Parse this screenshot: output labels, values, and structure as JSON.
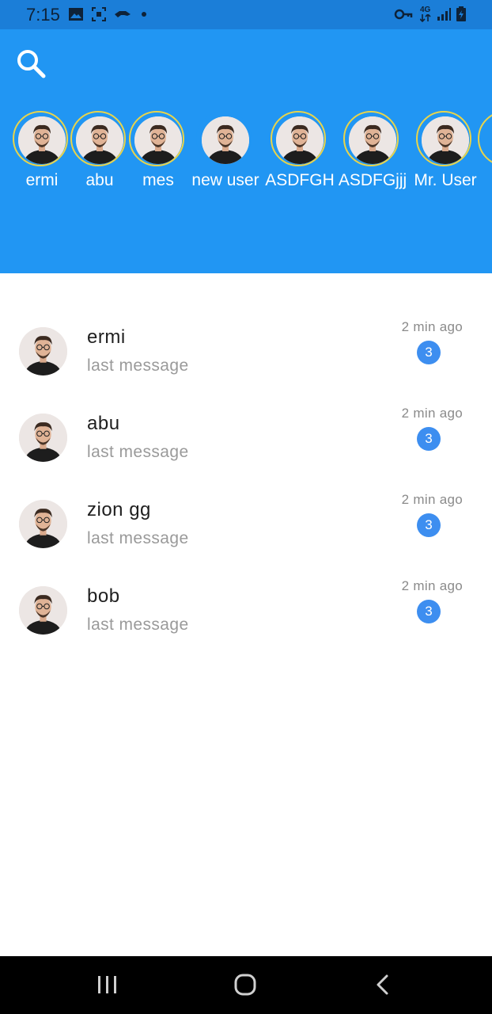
{
  "status_bar": {
    "time": "7:15",
    "left_icons": [
      "image-icon",
      "screenshot-icon",
      "game-controller-icon",
      "dot-icon"
    ],
    "right_icons": [
      "vpn-key-icon",
      "network-4g-icon",
      "signal-icon",
      "battery-icon"
    ],
    "network_label": "4G"
  },
  "header": {
    "background_color": "#2196f3",
    "search_icon": "search-icon"
  },
  "stories": [
    {
      "name": "ermi",
      "ring": true
    },
    {
      "name": "abu",
      "ring": true
    },
    {
      "name": "mes",
      "ring": true
    },
    {
      "name": "new user",
      "ring": false
    },
    {
      "name": "ASDFGH",
      "ring": true
    },
    {
      "name": "ASDFGjjj",
      "ring": true
    },
    {
      "name": "Mr. User",
      "ring": true
    }
  ],
  "chats": [
    {
      "name": "ermi",
      "message": "last message",
      "time": "2 min ago",
      "unread": "3"
    },
    {
      "name": "abu",
      "message": "last message",
      "time": "2 min ago",
      "unread": "3"
    },
    {
      "name": "zion gg",
      "message": "last message",
      "time": "2 min ago",
      "unread": "3"
    },
    {
      "name": "bob",
      "message": "last message",
      "time": "2 min ago",
      "unread": "3"
    }
  ],
  "colors": {
    "accent": "#2196f3",
    "badge": "#3d8ef0",
    "story_ring": "#e9d44a"
  },
  "nav_bar": {
    "buttons": [
      "recent-apps-icon",
      "home-icon",
      "back-icon"
    ]
  }
}
